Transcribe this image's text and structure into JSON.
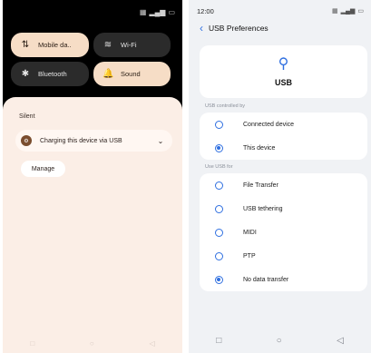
{
  "left": {
    "status_icons": [
      "wifi-icon",
      "signal-icon",
      "battery-icon"
    ],
    "tiles": [
      {
        "id": "mobile-data",
        "label": "Mobile da..",
        "icon": "mobile-data-icon",
        "state": "on"
      },
      {
        "id": "wifi",
        "label": "Wi-Fi",
        "icon": "wifi-icon",
        "state": "off"
      },
      {
        "id": "bluetooth",
        "label": "Bluetooth",
        "icon": "bluetooth-icon",
        "state": "off"
      },
      {
        "id": "sound",
        "label": "Sound",
        "icon": "bell-icon",
        "state": "on"
      }
    ],
    "sheet": {
      "silent_label": "Silent",
      "notification_text": "Charging this device via USB",
      "manage_label": "Manage"
    }
  },
  "right": {
    "time": "12:00",
    "title": "USB Preferences",
    "usb_label": "USB",
    "section_controlled": "USB controlled by",
    "controlled_options": [
      {
        "label": "Connected device",
        "selected": false
      },
      {
        "label": "This device",
        "selected": true
      }
    ],
    "section_use": "Use USB for",
    "use_options": [
      {
        "label": "File Transfer",
        "selected": false
      },
      {
        "label": "USB tethering",
        "selected": false
      },
      {
        "label": "MIDI",
        "selected": false
      },
      {
        "label": "PTP",
        "selected": false
      },
      {
        "label": "No data transfer",
        "selected": true
      }
    ]
  },
  "colors": {
    "accent": "#2f6fe0",
    "tile_on": "#f6ddc6",
    "tile_off": "#2b2b2b",
    "sheet_bg": "#fbeee6"
  }
}
